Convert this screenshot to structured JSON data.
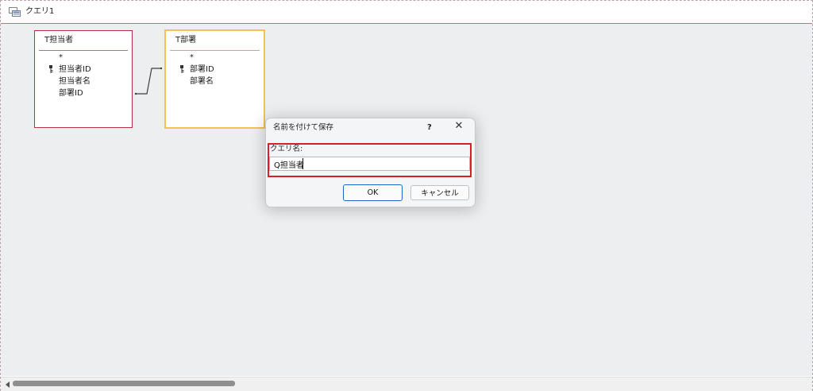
{
  "window": {
    "title": "クエリ1",
    "icon_name": "query-icon"
  },
  "tables": [
    {
      "name": "T担当者",
      "fields": [
        "*",
        "担当者ID",
        "担当者名",
        "部署ID"
      ],
      "primary_key": "担当者ID",
      "selected": false
    },
    {
      "name": "T部署",
      "fields": [
        "*",
        "部署ID",
        "部署名"
      ],
      "primary_key": "部署ID",
      "selected": true
    }
  ],
  "relationship": {
    "from": "T担当者.部署ID",
    "to": "T部署.部署ID"
  },
  "dialog": {
    "title": "名前を付けて保存",
    "help_label": "?",
    "close_label": "✕",
    "field_label": "クエリ名:",
    "query_name": "Q担当者",
    "ok_label": "OK",
    "cancel_label": "キャンセル"
  },
  "scrollbar": {
    "orientation": "horizontal",
    "position_fraction": 0
  },
  "colors": {
    "title_border": "#a57d7d",
    "table_border": "#b5333f",
    "selected_table_border": "#f3c34e",
    "highlight": "#d81e28",
    "default_button_border": "#1c66c7",
    "canvas_background": "#eceef0"
  }
}
